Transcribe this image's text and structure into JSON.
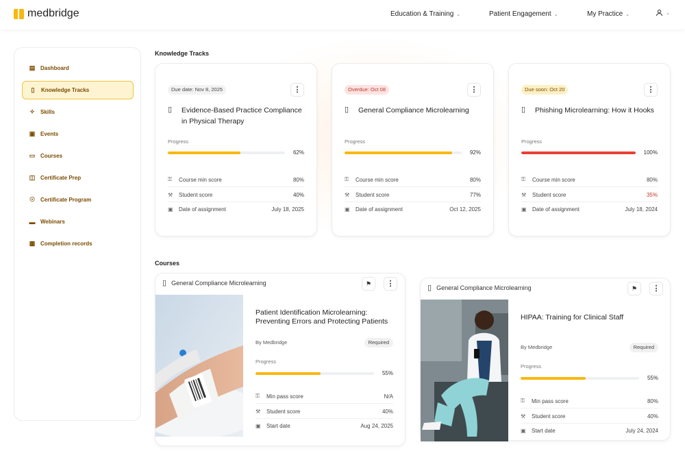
{
  "brand": {
    "name": "medbridge",
    "accent": "#f9b811"
  },
  "nav": {
    "education": "Education & Training",
    "patient": "Patient Engagement",
    "practice": "My Practice"
  },
  "sidebar": {
    "items": [
      {
        "label": "Dashboard",
        "icon": "dashboard-icon"
      },
      {
        "label": "Knowledge Tracks",
        "icon": "book-icon",
        "active": true
      },
      {
        "label": "Skills",
        "icon": "sparkle-icon"
      },
      {
        "label": "Events",
        "icon": "calendar-icon"
      },
      {
        "label": "Courses",
        "icon": "presentation-icon"
      },
      {
        "label": "Certificate Prep",
        "icon": "open-book-icon"
      },
      {
        "label": "Certificate Program",
        "icon": "award-icon"
      },
      {
        "label": "Webinars",
        "icon": "monitor-icon"
      },
      {
        "label": "Completion records",
        "icon": "table-icon"
      }
    ]
  },
  "knowledge_tracks": {
    "title": "Knowledge Tracks",
    "cards": [
      {
        "badge": "Due date: Nov 8, 2025",
        "badge_bg": "#f2f2f2",
        "badge_color": "#444",
        "title": "Evidence-Based Practice Compliance in Physical Therapy",
        "progress_label": "Progress",
        "progress": 62,
        "progress_text": "62%",
        "bar_color": "#f9b811",
        "min_label": "Course min score",
        "min_value": "80%",
        "student_label": "Student score",
        "student_value": "40%",
        "student_color": "#333",
        "date_label": "Date of assignment",
        "date_value": "July 18, 2025"
      },
      {
        "badge": "Overdue: Oct 08",
        "badge_bg": "#fde2e1",
        "badge_color": "#c0392b",
        "title": "General Compliance Microlearning",
        "progress_label": "Progress",
        "progress": 92,
        "progress_text": "92%",
        "bar_color": "#f9b811",
        "min_label": "Course min score",
        "min_value": "80%",
        "student_label": "Student score",
        "student_value": "77%",
        "student_color": "#333",
        "date_label": "Date of assignment",
        "date_value": "Oct 12, 2025"
      },
      {
        "badge": "Due soon: Oct 20",
        "badge_bg": "#fdf0c4",
        "badge_color": "#7a4b00",
        "title": "Phishing Microlearning: How it Hooks",
        "progress_label": "Progress",
        "progress": 100,
        "progress_text": "100%",
        "bar_color": "#e84034",
        "min_label": "Course min score",
        "min_value": "80%",
        "student_label": "Student score",
        "student_value": "35%",
        "student_color": "#c0392b",
        "date_label": "Date of assignment",
        "date_value": "July 18, 2024"
      }
    ]
  },
  "courses": {
    "title": "Courses",
    "cards": [
      {
        "header": "General Compliance Microlearning",
        "title": "Patient Identification Microlearning: Preventing Errors and Protecting Patients",
        "by": "By Medbridge",
        "tag": "Required",
        "progress_label": "Progress",
        "progress": 55,
        "progress_text": "55%",
        "pass_label": "Min pass score",
        "pass_value": "N/A",
        "student_label": "Student score",
        "student_value": "40%",
        "date_label": "Start date",
        "date_value": "Aug 24, 2025"
      },
      {
        "header": "General Compliance Microlearning",
        "title": "HIPAA: Training for Clinical Staff",
        "by": "By Medbridge",
        "tag": "Required",
        "progress_label": "Progress",
        "progress": 55,
        "progress_text": "55%",
        "pass_label": "Min pass score",
        "pass_value": "80%",
        "student_label": "Student score",
        "student_value": "40%",
        "date_label": "Start date",
        "date_value": "July 24, 2024"
      }
    ]
  }
}
